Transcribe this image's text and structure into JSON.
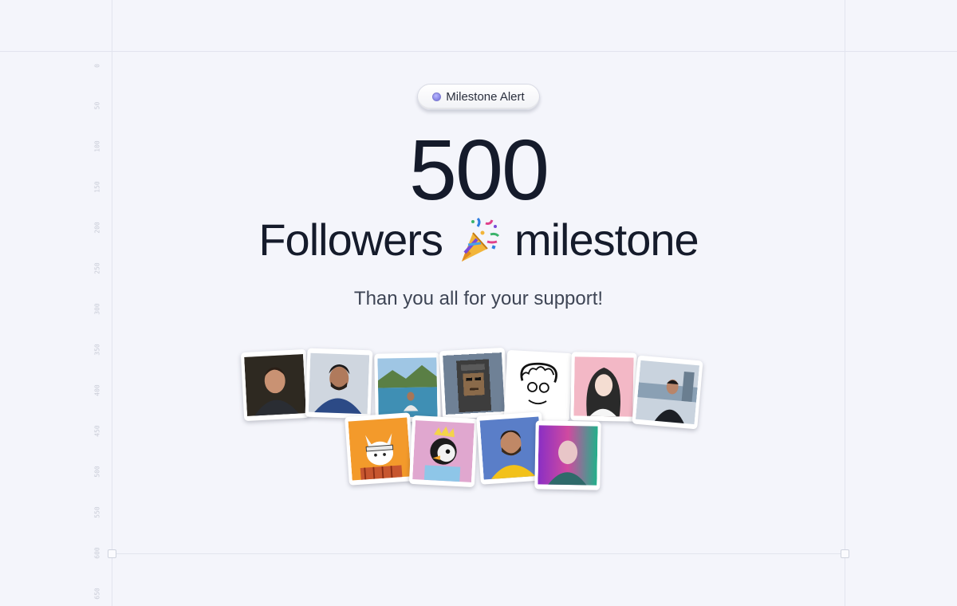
{
  "badge": {
    "label": "Milestone Alert",
    "dot_color": "#7b78df"
  },
  "milestone": {
    "number": "500",
    "label_before": "Followers",
    "icon": "party-popper-icon",
    "label_after": "milestone",
    "subtitle": "Than you all for your support!"
  },
  "ruler": {
    "ticks": [
      "0",
      "50",
      "100",
      "150",
      "200",
      "250",
      "300",
      "350",
      "400",
      "450",
      "500",
      "550",
      "600",
      "650"
    ]
  },
  "avatars": [
    {
      "name": "avatar-man-dark-hair"
    },
    {
      "name": "avatar-man-beard-blue-shirt"
    },
    {
      "name": "avatar-man-lake"
    },
    {
      "name": "avatar-pixel-art-hood"
    },
    {
      "name": "avatar-sketch-curly-glasses"
    },
    {
      "name": "avatar-illustrated-woman"
    },
    {
      "name": "avatar-man-city"
    },
    {
      "name": "avatar-fox-cartoon"
    },
    {
      "name": "avatar-penguin-cartoon"
    },
    {
      "name": "avatar-man-beard-yellow-shirt"
    },
    {
      "name": "avatar-bald-man-neon"
    }
  ],
  "colors": {
    "background": "#f4f5fb",
    "text": "#151b2b",
    "muted": "#3e4555"
  }
}
